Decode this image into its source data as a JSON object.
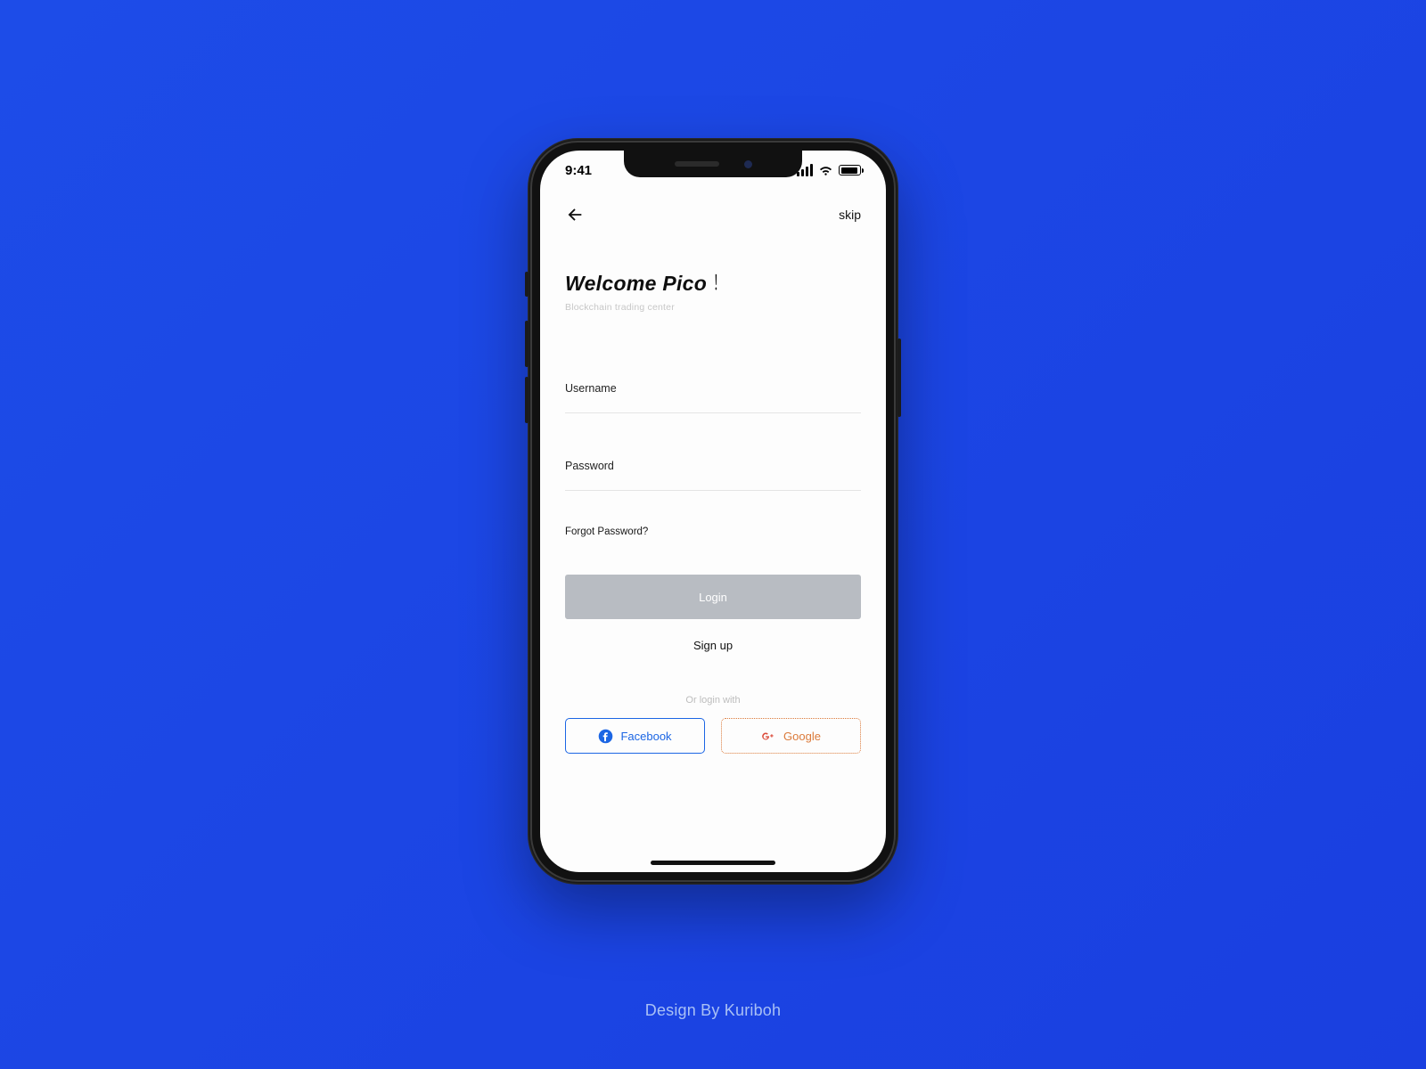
{
  "credit": "Design By Kuriboh",
  "status": {
    "time": "9:41"
  },
  "nav": {
    "skip_label": "skip"
  },
  "hero": {
    "title_prefix": "Welcome  Pico",
    "title_bang": "！",
    "subtitle": "Blockchain trading center"
  },
  "form": {
    "username_label": "Username",
    "password_label": "Password",
    "forgot_label": "Forgot Password?",
    "login_label": "Login",
    "signup_label": "Sign up"
  },
  "alt": {
    "divider": "Or login with",
    "facebook_label": "Facebook",
    "google_label": "Google"
  },
  "colors": {
    "bg": "#1c49e7",
    "fb": "#1c66e4",
    "gg": "#db7a3a",
    "login_btn": "#b8bcc2"
  }
}
